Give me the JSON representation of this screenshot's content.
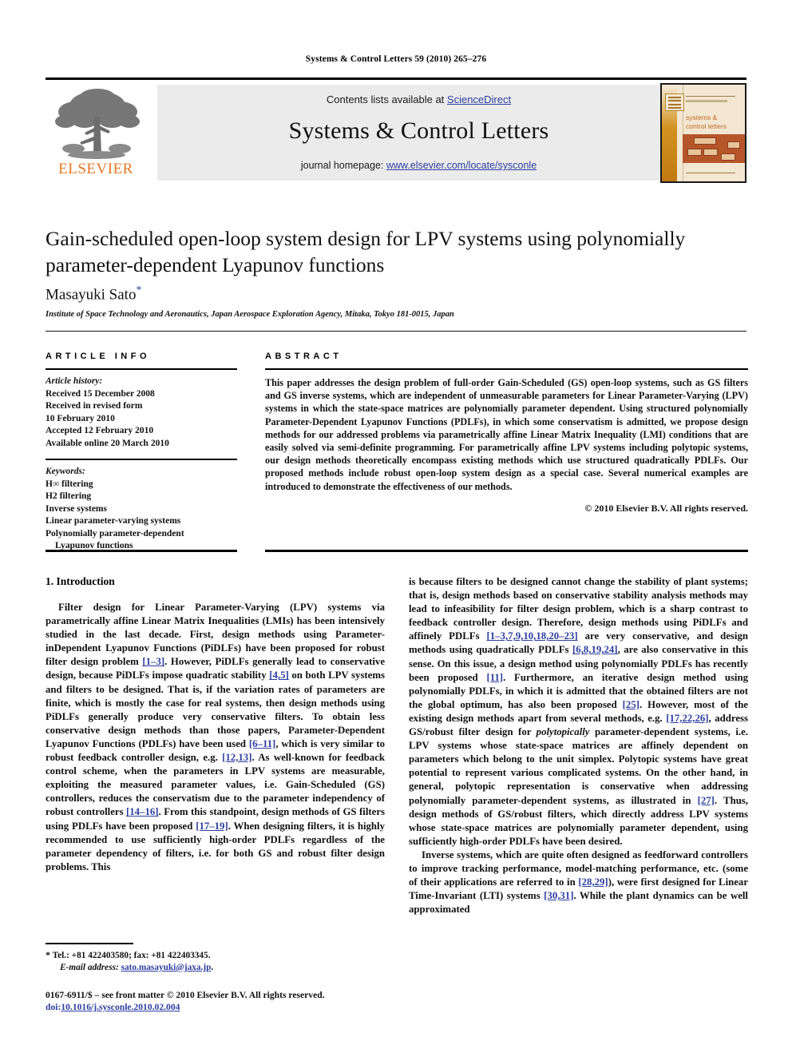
{
  "running_head": "Systems & Control Letters 59 (2010) 265–276",
  "masthead": {
    "publisher_wordmark": "ELSEVIER",
    "contents_prefix": "Contents lists available at ",
    "contents_link": "ScienceDirect",
    "journal_name": "Systems & Control Letters",
    "homepage_prefix": "journal homepage: ",
    "homepage_link": "www.elsevier.com/locate/sysconle",
    "cover_title_line1": "systems &",
    "cover_title_line2": "control letters"
  },
  "article": {
    "title": "Gain-scheduled open-loop system design for LPV systems using polynomially parameter-dependent Lyapunov functions",
    "author": "Masayuki Sato",
    "author_marker": "*",
    "affiliation": "Institute of Space Technology and Aeronautics, Japan Aerospace Exploration Agency, Mitaka, Tokyo 181-0015, Japan"
  },
  "article_info": {
    "heading": "ARTICLE INFO",
    "history_label": "Article history:",
    "history": [
      "Received 15 December 2008",
      "Received in revised form",
      "10 February 2010",
      "Accepted 12 February 2010",
      "Available online 20 March 2010"
    ],
    "keywords_label": "Keywords:",
    "keywords": [
      "H∞ filtering",
      "H2 filtering",
      "Inverse systems",
      "Linear parameter-varying systems",
      "Polynomially parameter-dependent"
    ],
    "keywords_continuation": "Lyapunov functions"
  },
  "abstract": {
    "heading": "ABSTRACT",
    "text": "This paper addresses the design problem of full-order Gain-Scheduled (GS) open-loop systems, such as GS filters and GS inverse systems, which are independent of unmeasurable parameters for Linear Parameter-Varying (LPV) systems in which the state-space matrices are polynomially parameter dependent. Using structured polynomially Parameter-Dependent Lyapunov Functions (PDLFs), in which some conservatism is admitted, we propose design methods for our addressed problems via parametrically affine Linear Matrix Inequality (LMI) conditions that are easily solved via semi-definite programming. For parametrically affine LPV systems including polytopic systems, our design methods theoretically encompass existing methods which use structured quadratically PDLFs. Our proposed methods include robust open-loop system design as a special case. Several numerical examples are introduced to demonstrate the effectiveness of our methods.",
    "copyright": "© 2010 Elsevier B.V. All rights reserved."
  },
  "body": {
    "section_heading": "1. Introduction",
    "left_p1_a": "Filter design for Linear Parameter-Varying (LPV) systems via parametrically affine Linear Matrix Inequalities (LMIs) has been intensively studied in the last decade. First, design methods using Parameter-inDependent Lyapunov Functions (PiDLFs) have been proposed for robust filter design problem ",
    "left_p1_c1": "[1–3]",
    "left_p1_b": ". However, PiDLFs generally lead to conservative design, because PiDLFs impose quadratic stability ",
    "left_p1_c2": "[4,5]",
    "left_p1_d": " on both LPV systems and filters to be designed. That is, if the variation rates of parameters are finite, which is mostly the case for real systems, then design methods using PiDLFs generally produce very conservative filters. To obtain less conservative design methods than those papers, Parameter-Dependent Lyapunov Functions (PDLFs) have been used ",
    "left_p1_c3": "[6–11]",
    "left_p1_e": ", which is very similar to robust feedback controller design, e.g. ",
    "left_p1_c4": "[12,13]",
    "left_p1_f": ". As well-known for feedback control scheme, when the parameters in LPV systems are measurable, exploiting the measured parameter values, i.e. Gain-Scheduled (GS) controllers, reduces the conservatism due to the parameter independency of robust controllers ",
    "left_p1_c5": "[14–16]",
    "left_p1_g": ". From this standpoint, design methods of GS filters using PDLFs have been proposed ",
    "left_p1_c6": "[17–19]",
    "left_p1_h": ". When designing filters, it is highly recommended to use sufficiently high-order PDLFs regardless of the parameter dependency of filters, i.e. for both GS and robust filter design problems. This",
    "right_p1_a": "is because filters to be designed cannot change the stability of plant systems; that is, design methods based on conservative stability analysis methods may lead to infeasibility for filter design problem, which is a sharp contrast to feedback controller design. Therefore, design methods using PiDLFs and affinely PDLFs ",
    "right_p1_c1": "[1–3,7,9,10,18,20–23]",
    "right_p1_b": " are very conservative, and design methods using quadratically PDLFs ",
    "right_p1_c2": "[6,8,19,24]",
    "right_p1_c": ", are also conservative in this sense. On this issue, a design method using polynomially PDLFs has recently been proposed ",
    "right_p1_c3": "[11]",
    "right_p1_d": ". Furthermore, an iterative design method using polynomially PDLFs, in which it is admitted that the obtained filters are not the global optimum, has also been proposed ",
    "right_p1_c4": "[25]",
    "right_p1_e": ". However, most of the existing design methods apart from several methods, e.g. ",
    "right_p1_c5": "[17,22,26]",
    "right_p1_f": ", address GS/robust filter design for ",
    "right_p1_ital": "polytopically",
    "right_p1_g": " parameter-dependent systems, i.e. LPV systems whose state-space matrices are affinely dependent on parameters which belong to the unit simplex. Polytopic systems have great potential to represent various complicated systems. On the other hand, in general, polytopic representation is conservative when addressing polynomially parameter-dependent systems, as illustrated in ",
    "right_p1_c6": "[27]",
    "right_p1_h": ". Thus, design methods of GS/robust filters, which directly address LPV systems whose state-space matrices are polynomially parameter dependent, using sufficiently high-order PDLFs have been desired.",
    "right_p2_a": "Inverse systems, which are quite often designed as feedforward controllers to improve tracking performance, model-matching performance, etc. (some of their applications are referred to in ",
    "right_p2_c1": "[28,29]",
    "right_p2_b": "), were first designed for Linear Time-Invariant (LTI) systems ",
    "right_p2_c2": "[30,31]",
    "right_p2_c": ". While the plant dynamics can be well approximated"
  },
  "footnote": {
    "marker": "*",
    "contact": "Tel.: +81 422403580; fax: +81 422403345.",
    "email_label": "E-mail address:",
    "email": "sato.masayuki@jaxa.jp",
    "email_suffix": "."
  },
  "imprint": {
    "line1": "0167-6911/$ – see front matter © 2010 Elsevier B.V. All rights reserved.",
    "doi_prefix": "doi:",
    "doi": "10.1016/j.sysconle.2010.02.004"
  }
}
